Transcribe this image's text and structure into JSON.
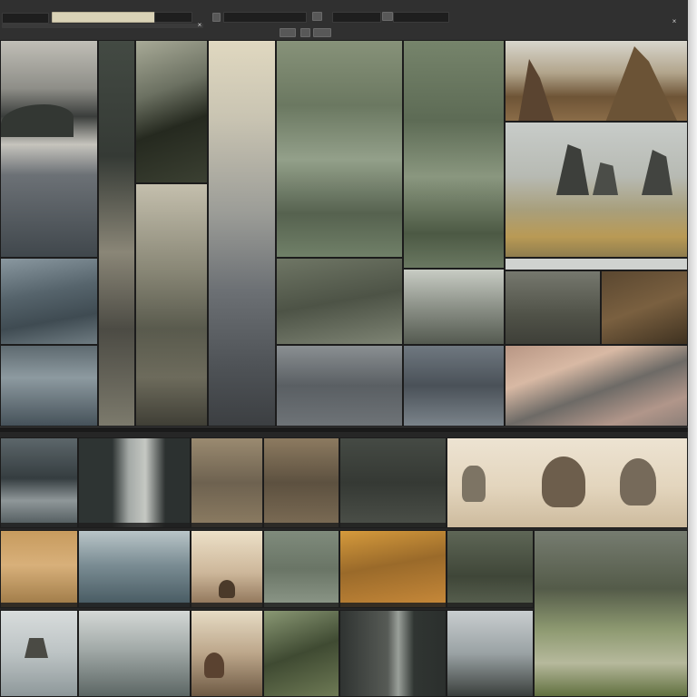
{
  "window": {
    "title": ""
  },
  "toolbar": {
    "search_placeholder": "",
    "icons": [
      "close-icon",
      "grid-view-icon",
      "list-view-icon",
      "close-icon"
    ]
  },
  "colors": {
    "toolbar_bg": "#303030",
    "panel_bg": "#262626",
    "divider": "#1a1a1a",
    "field_light": "#d9d2b6"
  },
  "gallery": {
    "top_tiles": [
      {
        "name": "tile-stormy-peak",
        "colors": [
          "#b9b7b0",
          "#3c3f3e",
          "#7c8186"
        ]
      },
      {
        "name": "tile-dark-strip",
        "colors": [
          "#3d423d",
          "#4b4e47",
          "#2e302c"
        ]
      },
      {
        "name": "tile-misty-cliff",
        "colors": [
          "#8e9280",
          "#2c2f28",
          "#585b50"
        ]
      },
      {
        "name": "tile-sunlit-fog",
        "colors": [
          "#d8d1bc",
          "#9a9b95",
          "#6a6e72"
        ]
      },
      {
        "name": "tile-green-clouds",
        "colors": [
          "#7f8c74",
          "#586650",
          "#3f4a3c"
        ]
      },
      {
        "name": "tile-green-haze",
        "colors": [
          "#6d7b63",
          "#5b6853",
          "#879380"
        ]
      },
      {
        "name": "tile-rock-spires",
        "colors": [
          "#d3d0c6",
          "#7a5f40",
          "#b5ab88"
        ]
      }
    ],
    "bottom_tiles": [
      {
        "name": "tile-coast-mist",
        "colors": [
          "#566066",
          "#9fa6a7",
          "#4a5358"
        ]
      },
      {
        "name": "tile-canyon",
        "colors": [
          "#4a5050",
          "#a5aaa8",
          "#2f3333"
        ]
      },
      {
        "name": "tile-amber-forest",
        "colors": [
          "#8f7a5c",
          "#5c5240",
          "#a89477"
        ]
      },
      {
        "name": "tile-golden-field",
        "colors": [
          "#c7a36b",
          "#8f7046",
          "#e0c18a"
        ]
      },
      {
        "name": "tile-creatures-desert",
        "colors": [
          "#e9dcc6",
          "#cbbba0",
          "#8a7560"
        ]
      },
      {
        "name": "tile-misty-woods",
        "colors": [
          "#6d7461",
          "#a5a98d",
          "#3f4737"
        ]
      }
    ]
  }
}
